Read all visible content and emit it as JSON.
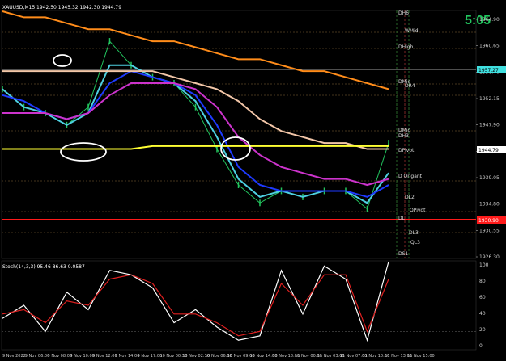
{
  "window": {
    "title": "XAUUSD,M15"
  },
  "header": {
    "ohlc": "XAUUSD,M15  1942.50 1945.32 1942.30 1944.79",
    "timer": "5:05"
  },
  "colors": {
    "background": "#000000",
    "price_candles": "#22c55e",
    "ma_fast": "#4dd0e1",
    "ma_mid": "#1e3aff",
    "ma_magenta": "#cc33cc",
    "ma_peach": "#f2c6a8",
    "ma_orange": "#ff8c1a",
    "ma_yellow": "#ffff33",
    "line_cyan_level": "#40e0e0",
    "red_level": "#ff1a1a",
    "stoch_main": "#ffffff",
    "stoch_signal": "#e02020",
    "timer": "#22c55e"
  },
  "price_axis": {
    "labels": [
      "1964.90",
      "1960.65",
      "1956.40",
      "1952.15",
      "1947.90",
      "1943.30",
      "1939.05",
      "1934.80",
      "1930.55",
      "1926.30"
    ],
    "current_price": "1944.79",
    "cyan_level_price": "1957.27",
    "red_level_price": "1930.90"
  },
  "pivot_labels": [
    "DH6",
    "WMid",
    "DHigh",
    "DMid",
    "DR4",
    "DMid",
    "DH3",
    "DPivot",
    "D Orlgant",
    "DL",
    "QPivot",
    "DL3",
    "QL3",
    "DS1",
    "DL2"
  ],
  "stoch_panel": {
    "label": "Stoch(14,3,3) 95.46 86.63 0.0587",
    "axis_labels": [
      "100",
      "80",
      "60",
      "40",
      "20",
      "0"
    ]
  },
  "time_axis": {
    "labels": [
      "9 Nov 2022",
      "9 Nov 06:00",
      "9 Nov 08:00",
      "9 Nov 10:00",
      "9 Nov 12:00",
      "9 Nov 14:00",
      "9 Nov 17:00",
      "10 Nov 00:30",
      "10 Nov 02:30",
      "10 Nov 06:00",
      "10 Nov 09:00",
      "10 Nov 14:00",
      "10 Nov 18:00",
      "11 Nov 00:00",
      "11 Nov 03:00",
      "11 Nov 07:00",
      "11 Nov 10:00",
      "11 Nov 13:00",
      "11 Nov 15:00"
    ]
  },
  "chart_data": [
    {
      "type": "line",
      "title": "XAUUSD,M15",
      "xlabel": "",
      "ylabel": "",
      "ylim": [
        1926,
        1967
      ],
      "x": [
        "9 Nov 2022",
        "9 Nov 06:00",
        "9 Nov 08:00",
        "9 Nov 10:00",
        "9 Nov 12:00",
        "9 Nov 14:00",
        "9 Nov 17:00",
        "10 Nov 00:30",
        "10 Nov 02:30",
        "10 Nov 06:00",
        "10 Nov 09:00",
        "10 Nov 14:00",
        "10 Nov 18:00",
        "11 Nov 00:00",
        "11 Nov 03:00",
        "11 Nov 07:00",
        "11 Nov 10:00",
        "11 Nov 13:00",
        "11 Nov 15:00"
      ],
      "series": [
        {
          "name": "",
          "color": "#22c55e",
          "values": [
            1954,
            1951,
            1950,
            1948,
            1951,
            1962,
            1958,
            1956,
            1955,
            1951,
            1944,
            1938,
            1935,
            1937,
            1936,
            1937,
            1937,
            1934,
            1945
          ]
        },
        {
          "name": "",
          "color": "#4dd0e1",
          "values": [
            1954,
            1951,
            1950,
            1948,
            1950,
            1958,
            1958,
            1956,
            1955,
            1952,
            1946,
            1939,
            1936,
            1937,
            1936,
            1937,
            1937,
            1935,
            1940
          ]
        },
        {
          "name": "",
          "color": "#1e3aff",
          "values": [
            1953,
            1952,
            1950,
            1949,
            1950,
            1955,
            1957,
            1956,
            1955,
            1953,
            1948,
            1941,
            1938,
            1937,
            1937,
            1937,
            1937,
            1936,
            1938
          ]
        },
        {
          "name": "",
          "color": "#cc33cc",
          "values": [
            1950,
            1950,
            1950,
            1949,
            1950,
            1953,
            1955,
            1955,
            1955,
            1954,
            1951,
            1946,
            1943,
            1941,
            1940,
            1939,
            1939,
            1938,
            1939
          ]
        },
        {
          "name": "",
          "color": "#f2c6a8",
          "values": [
            1957,
            1957,
            1957,
            1957,
            1957,
            1957,
            1957,
            1957,
            1956,
            1955,
            1954,
            1952,
            1949,
            1947,
            1946,
            1945,
            1945,
            1944,
            1944
          ]
        },
        {
          "name": "",
          "color": "#ff8c1a",
          "values": [
            1967,
            1966,
            1966,
            1965,
            1964,
            1964,
            1963,
            1962,
            1962,
            1961,
            1960,
            1959,
            1959,
            1958,
            1957,
            1957,
            1956,
            1955,
            1954
          ]
        },
        {
          "name": "",
          "color": "#ffff33",
          "values": [
            1944,
            1944,
            1944,
            1944,
            1944,
            1944,
            1944,
            1944.5,
            1944.5,
            1944.5,
            1944.5,
            1944.5,
            1944.5,
            1944.5,
            1944.5,
            1944.5,
            1944.5,
            1944.5,
            1944.5
          ]
        }
      ]
    },
    {
      "type": "line",
      "title": "Stoch(14,3,3) 95.46 86.63 0.0587",
      "xlabel": "",
      "ylabel": "",
      "ylim": [
        0,
        100
      ],
      "x": [
        "9 Nov 2022",
        "9 Nov 06:00",
        "9 Nov 08:00",
        "9 Nov 10:00",
        "9 Nov 12:00",
        "9 Nov 14:00",
        "9 Nov 17:00",
        "10 Nov 00:30",
        "10 Nov 02:30",
        "10 Nov 06:00",
        "10 Nov 09:00",
        "10 Nov 14:00",
        "10 Nov 18:00",
        "11 Nov 00:00",
        "11 Nov 03:00",
        "11 Nov 07:00",
        "11 Nov 10:00",
        "11 Nov 13:00",
        "11 Nov 15:00"
      ],
      "series": [
        {
          "name": "",
          "color": "#ffffff",
          "values": [
            35,
            50,
            20,
            65,
            45,
            90,
            85,
            70,
            30,
            45,
            25,
            10,
            15,
            90,
            40,
            95,
            80,
            10,
            100
          ]
        },
        {
          "name": "",
          "color": "#e02020",
          "values": [
            40,
            45,
            30,
            55,
            50,
            80,
            85,
            75,
            40,
            40,
            30,
            15,
            20,
            75,
            50,
            85,
            85,
            20,
            80
          ]
        }
      ]
    }
  ]
}
